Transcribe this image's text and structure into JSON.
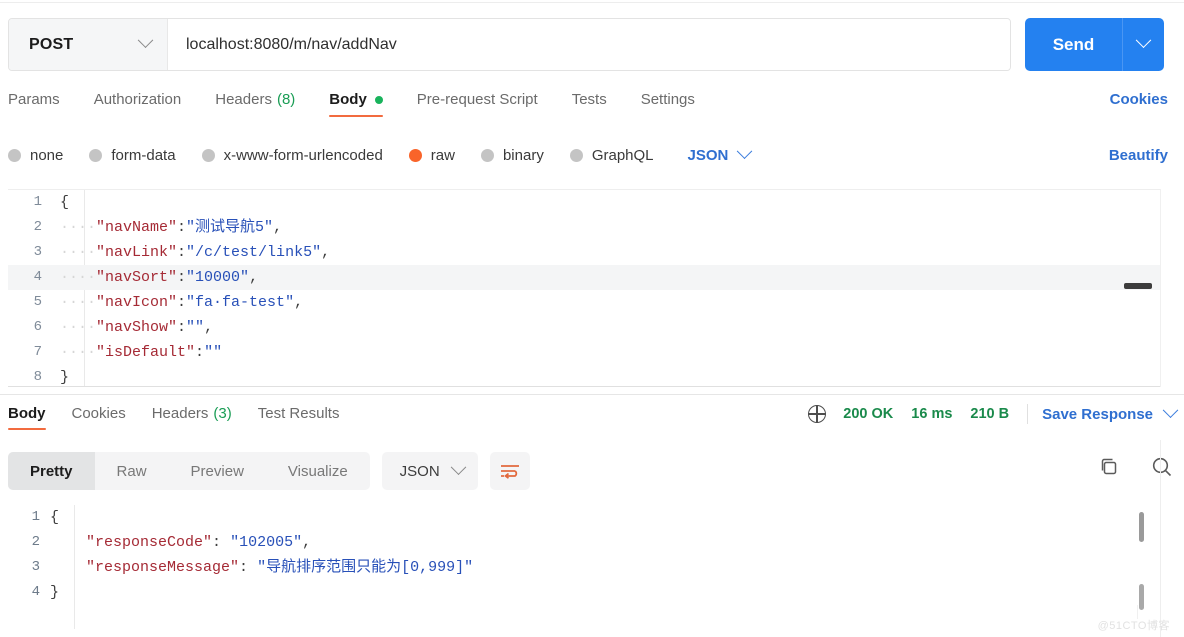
{
  "request": {
    "method": "POST",
    "url": "localhost:8080/m/nav/addNav",
    "send_label": "Send",
    "tabs": [
      {
        "label": "Params",
        "active": false,
        "count": "",
        "dot": false
      },
      {
        "label": "Authorization",
        "active": false,
        "count": "",
        "dot": false
      },
      {
        "label": "Headers",
        "active": false,
        "count": "(8)",
        "dot": false
      },
      {
        "label": "Body",
        "active": true,
        "count": "",
        "dot": true
      },
      {
        "label": "Pre-request Script",
        "active": false,
        "count": "",
        "dot": false
      },
      {
        "label": "Tests",
        "active": false,
        "count": "",
        "dot": false
      },
      {
        "label": "Settings",
        "active": false,
        "count": "",
        "dot": false
      }
    ],
    "cookies_label": "Cookies",
    "body_types": [
      {
        "label": "none",
        "selected": false
      },
      {
        "label": "form-data",
        "selected": false
      },
      {
        "label": "x-www-form-urlencoded",
        "selected": false
      },
      {
        "label": "raw",
        "selected": true
      },
      {
        "label": "binary",
        "selected": false
      },
      {
        "label": "GraphQL",
        "selected": false
      }
    ],
    "format": "JSON",
    "beautify_label": "Beautify",
    "body_lines": [
      {
        "no": "1",
        "indent": "",
        "key": "",
        "colon": "",
        "value": "",
        "comma": "",
        "brace": "{",
        "highlight": false
      },
      {
        "no": "2",
        "indent": "····",
        "key": "\"navName\"",
        "colon": ":",
        "value": "\"测试导航5\"",
        "comma": ",",
        "brace": "",
        "highlight": false
      },
      {
        "no": "3",
        "indent": "····",
        "key": "\"navLink\"",
        "colon": ":",
        "value": "\"/c/test/link5\"",
        "comma": ",",
        "brace": "",
        "highlight": false
      },
      {
        "no": "4",
        "indent": "····",
        "key": "\"navSort\"",
        "colon": ":",
        "value": "\"10000\"",
        "comma": ",",
        "brace": "",
        "highlight": true
      },
      {
        "no": "5",
        "indent": "····",
        "key": "\"navIcon\"",
        "colon": ":",
        "value": "\"fa·fa-test\"",
        "comma": ",",
        "brace": "",
        "highlight": false
      },
      {
        "no": "6",
        "indent": "····",
        "key": "\"navShow\"",
        "colon": ":",
        "value": "\"\"",
        "comma": ",",
        "brace": "",
        "highlight": false
      },
      {
        "no": "7",
        "indent": "····",
        "key": "\"isDefault\"",
        "colon": ":",
        "value": "\"\"",
        "comma": "",
        "brace": "",
        "highlight": false
      },
      {
        "no": "8",
        "indent": "",
        "key": "",
        "colon": "",
        "value": "",
        "comma": "",
        "brace": "}",
        "highlight": false
      }
    ]
  },
  "response": {
    "tabs": [
      {
        "label": "Body",
        "active": true,
        "count": ""
      },
      {
        "label": "Cookies",
        "active": false,
        "count": ""
      },
      {
        "label": "Headers",
        "active": false,
        "count": "(3)"
      },
      {
        "label": "Test Results",
        "active": false,
        "count": ""
      }
    ],
    "status": "200 OK",
    "time": "16 ms",
    "size": "210 B",
    "save_label": "Save Response",
    "view_modes": [
      {
        "label": "Pretty",
        "active": true
      },
      {
        "label": "Raw",
        "active": false
      },
      {
        "label": "Preview",
        "active": false
      },
      {
        "label": "Visualize",
        "active": false
      }
    ],
    "format": "JSON",
    "body_lines": [
      {
        "no": "1",
        "indent": "",
        "key": "",
        "colon": "",
        "value": "",
        "comma": "",
        "brace": "{"
      },
      {
        "no": "2",
        "indent": "    ",
        "key": "\"responseCode\"",
        "colon": ": ",
        "value": "\"102005\"",
        "comma": ",",
        "brace": ""
      },
      {
        "no": "3",
        "indent": "    ",
        "key": "\"responseMessage\"",
        "colon": ": ",
        "value": "\"导航排序范围只能为[0,999]\"",
        "comma": "",
        "brace": ""
      },
      {
        "no": "4",
        "indent": "",
        "key": "",
        "colon": "",
        "value": "",
        "comma": "",
        "brace": "}"
      }
    ]
  },
  "watermark": "@51CTO博客",
  "colors": {
    "accent_blue": "#2481f0",
    "link_blue": "#2f6fd0",
    "active_orange": "#f26b3f",
    "radio_orange": "#f9642a",
    "status_green": "#1a8a4b",
    "count_green": "#1a9d55",
    "json_key": "#a52a35",
    "json_value": "#2850b8"
  }
}
